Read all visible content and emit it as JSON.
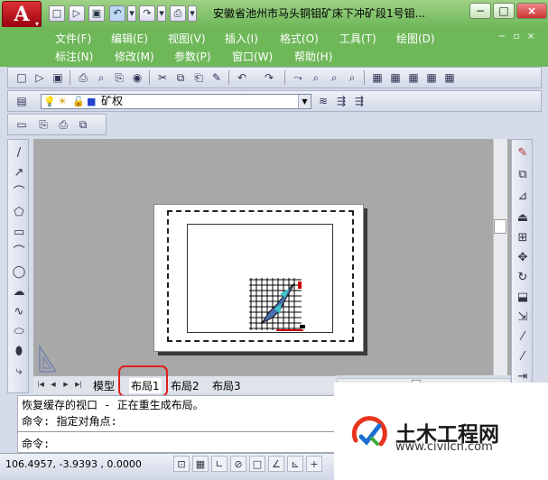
{
  "window": {
    "title": "安徽省池州市马头铜钼矿床下冲矿段1号钼...",
    "minimize": "−",
    "restore": "□",
    "close": "×"
  },
  "app_button": {
    "logo": "A",
    "arrow": "▾"
  },
  "quick_access": [
    "□",
    "▷",
    "▣",
    "↶",
    "▾",
    "↷",
    "▾",
    "⎙",
    "▾"
  ],
  "menu_row1": [
    "文件(F)",
    "编辑(E)",
    "视图(V)",
    "插入(I)",
    "格式(O)",
    "工具(T)",
    "绘图(D)"
  ],
  "menu_row2": [
    "标注(N)",
    "修改(M)",
    "参数(P)",
    "窗口(W)",
    "帮助(H)"
  ],
  "mdi_controls": [
    "−",
    "▫",
    "×"
  ],
  "standard_toolbar": [
    "□",
    "▷",
    "▣",
    "⎙",
    "⌕",
    "⎘",
    "◉",
    "✂",
    "⧉",
    "⎗",
    "✎",
    "↶",
    "↷",
    "⤳",
    "⌕",
    "⌕",
    "⌕",
    "▦",
    "▦",
    "▦",
    "▦",
    "▦"
  ],
  "layers_toolbar": {
    "layer_name": "矿权",
    "layer_icons": [
      "💡",
      "☀",
      "🔓",
      "■"
    ],
    "buttons": [
      "≋",
      "⇶",
      "⇶"
    ]
  },
  "left_tools": [
    "/",
    "↗",
    "⌒",
    "⬠",
    "▭",
    "⌒",
    "◯",
    "☁",
    "∿",
    "⬭",
    "⬮",
    "⤷",
    "▦",
    "A"
  ],
  "right_tools": [
    "✎",
    "⧉",
    "⊿",
    "⏏",
    "⊞",
    "✥",
    "↻",
    "⬓",
    "⇲",
    "⁄",
    "⁄",
    "⇥"
  ],
  "tabs": [
    "模型",
    "布局1",
    "布局2",
    "布局3"
  ],
  "tab_nav": [
    "|◀",
    "◀",
    "▶",
    "▶|"
  ],
  "command": {
    "lines": [
      "恢复缓存的视口 - 正在重生成布局。",
      "命令: 指定对角点:"
    ],
    "prompt": "命令:"
  },
  "status": {
    "coords": "106.4957, -3.9393 , 0.0000",
    "buttons": [
      "⊡",
      "▦",
      "∟",
      "⊘",
      "□",
      "∠",
      "⊾",
      "+"
    ]
  },
  "watermark": {
    "title": "土木工程网",
    "url": "www.civilcn.com"
  },
  "colors": {
    "titlebar_green": "#6fb85a",
    "highlight_red": "#e0201a",
    "model_space_gray": "#a8a8a8"
  }
}
